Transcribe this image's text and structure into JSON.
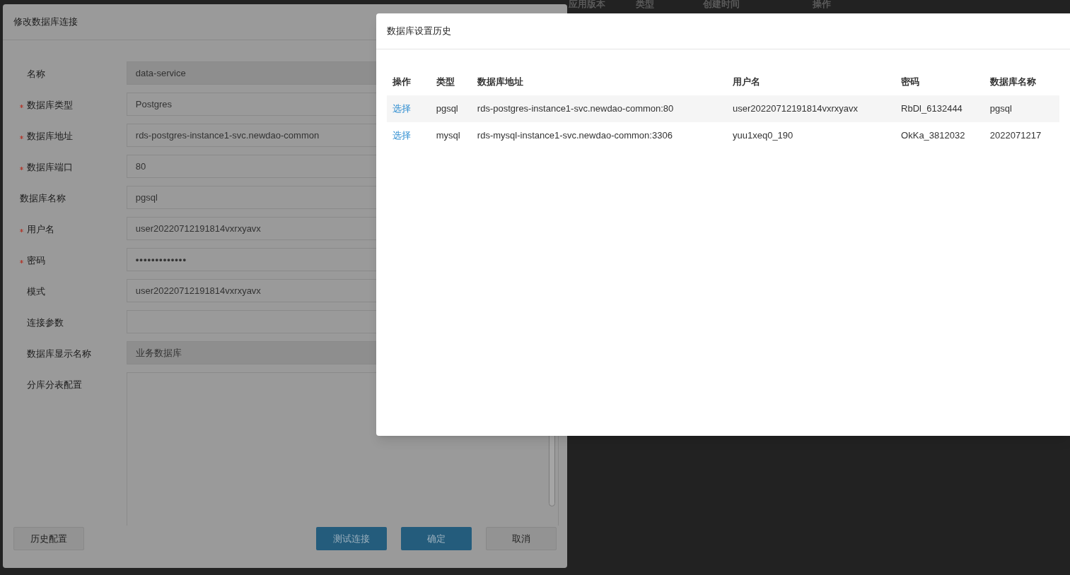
{
  "background_table": {
    "columns": [
      "应用版本",
      "类型",
      "创建时间",
      "操作"
    ]
  },
  "edit_dialog": {
    "title": "修改数据库连接",
    "fields": [
      {
        "kind": "input",
        "label": "名称",
        "required": false,
        "disabled": true,
        "value": "data-service"
      },
      {
        "kind": "input",
        "label": "数据库类型",
        "required": true,
        "disabled": false,
        "value": "Postgres"
      },
      {
        "kind": "input",
        "label": "数据库地址",
        "required": true,
        "disabled": false,
        "value": "rds-postgres-instance1-svc.newdao-common"
      },
      {
        "kind": "input",
        "label": "数据库端口",
        "required": true,
        "disabled": false,
        "value": "80"
      },
      {
        "kind": "input",
        "label": "数据库名称",
        "required": false,
        "disabled": false,
        "value": "pgsql"
      },
      {
        "kind": "input",
        "label": "用户名",
        "required": true,
        "disabled": false,
        "value": "user20220712191814vxrxyavx"
      },
      {
        "kind": "password",
        "label": "密码",
        "required": true,
        "disabled": false,
        "value": "•••••••••••••"
      },
      {
        "kind": "input",
        "label": "模式",
        "required": false,
        "disabled": false,
        "value": "user20220712191814vxrxyavx"
      },
      {
        "kind": "input",
        "label": "连接参数",
        "required": false,
        "disabled": false
      },
      {
        "kind": "input",
        "label": "数据库显示名称",
        "required": false,
        "disabled": true,
        "value": "业务数据库"
      },
      {
        "kind": "textarea",
        "label": "分库分表配置",
        "required": false,
        "disabled": false
      }
    ],
    "buttons": [
      {
        "label": "历史配置",
        "kind": "default"
      },
      {
        "label": "测试连接",
        "kind": "primary"
      },
      {
        "label": "确定",
        "kind": "primary"
      },
      {
        "label": "取消",
        "kind": "default"
      }
    ]
  },
  "history_dialog": {
    "title": "数据库设置历史",
    "table": {
      "columns": [
        "操作",
        "类型",
        "数据库地址",
        "用户名",
        "密码",
        "数据库名称"
      ],
      "rows": [
        {
          "cells": [
            "选择",
            "pgsql",
            "rds-postgres-instance1-svc.newdao-common:80",
            "user20220712191814vxrxyavx",
            "RbDl_6132444",
            "pgsql"
          ]
        },
        {
          "cells": [
            "选择",
            "mysql",
            "rds-mysql-instance1-svc.newdao-common:3306",
            "yuu1xeq0_190",
            "OkKa_3812032",
            "2022071217"
          ]
        }
      ]
    }
  }
}
